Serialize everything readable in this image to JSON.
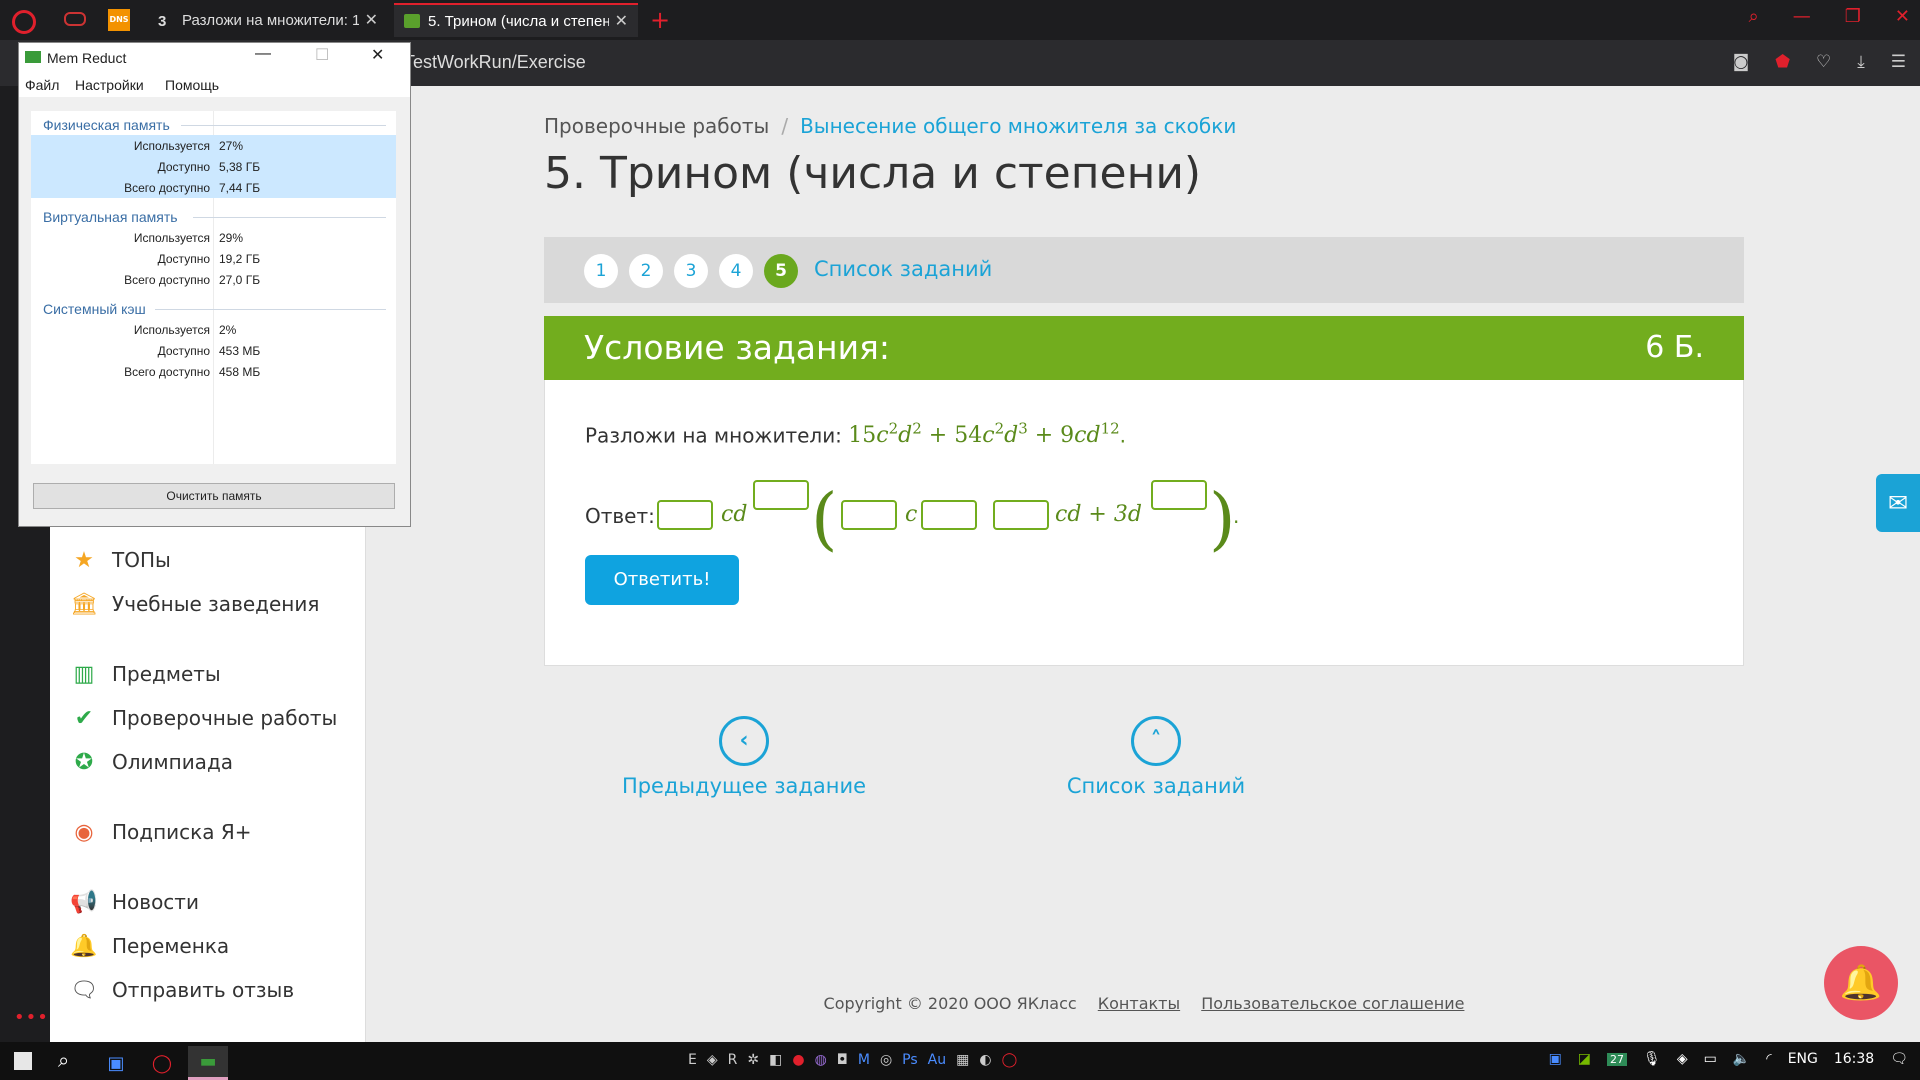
{
  "browser": {
    "tabs": [
      {
        "badge": "3",
        "title": "Разложи на множители: 1"
      },
      {
        "title": "5. Трином (числа и степен"
      }
    ],
    "url": "TestWorkRun/Exercise",
    "icons": [
      "camera-icon",
      "shield-icon",
      "heart-icon",
      "download-icon",
      "settings-icon"
    ]
  },
  "sidebar": {
    "items": [
      {
        "label": "ТОПы",
        "icon": "star-icon",
        "color": "#f5a623"
      },
      {
        "label": "Учебные заведения",
        "icon": "building-icon",
        "color": "#f5a623"
      },
      {
        "label": "Предметы",
        "icon": "books-icon",
        "color": "#2eaa4a"
      },
      {
        "label": "Проверочные работы",
        "icon": "check-circle-icon",
        "color": "#2eaa4a"
      },
      {
        "label": "Олимпиада",
        "icon": "medal-icon",
        "color": "#2eaa4a"
      },
      {
        "label": "Подписка Я+",
        "icon": "subscription-icon",
        "color": "#e8643c"
      },
      {
        "label": "Новости",
        "icon": "megaphone-icon",
        "color": "#555555"
      },
      {
        "label": "Переменка",
        "icon": "bell-icon",
        "color": "#555555"
      },
      {
        "label": "Отправить отзыв",
        "icon": "feedback-icon",
        "color": "#555555"
      }
    ]
  },
  "breadcrumbs": {
    "root": "Проверочные работы",
    "separator": "/",
    "current": "Вынесение общего множителя за скобки"
  },
  "page_title": "5. Трином (числа и степени)",
  "task_nav": {
    "numbers": [
      "1",
      "2",
      "3",
      "4",
      "5"
    ],
    "active_index": 4,
    "list_link": "Список заданий"
  },
  "condition": {
    "header": "Условие задания:",
    "score": "6 Б.",
    "prompt": "Разложи на множители:",
    "answer_label": "Ответ:",
    "submit": "Ответить!"
  },
  "bottom_nav": {
    "prev": "Предыдущее задание",
    "list": "Список заданий"
  },
  "footer": {
    "copyright": "Copyright © 2020 ООО ЯКласс",
    "contacts": "Контакты",
    "agreement": "Пользовательское соглашение"
  },
  "memreduct": {
    "title": "Mem Reduct",
    "menu": [
      "Файл",
      "Настройки",
      "Помощь"
    ],
    "groups": [
      {
        "name": "Физическая память",
        "rows": [
          [
            "Используется",
            "27%"
          ],
          [
            "Доступно",
            "5,38 ГБ"
          ],
          [
            "Всего доступно",
            "7,44 ГБ"
          ]
        ]
      },
      {
        "name": "Виртуальная память",
        "rows": [
          [
            "Используется",
            "29%"
          ],
          [
            "Доступно",
            "19,2 ГБ"
          ],
          [
            "Всего доступно",
            "27,0 ГБ"
          ]
        ]
      },
      {
        "name": "Системный кэш",
        "rows": [
          [
            "Используется",
            "2%"
          ],
          [
            "Доступно",
            "453 МБ"
          ],
          [
            "Всего доступно",
            "458 МБ"
          ]
        ]
      }
    ],
    "button": "Очистить память"
  },
  "taskbar": {
    "badge": "27",
    "language": "ENG",
    "time": "16:38"
  },
  "colors": {
    "accent_green": "#72ad1e",
    "link_blue": "#1ba3d6",
    "browser_red": "#e0202c"
  }
}
